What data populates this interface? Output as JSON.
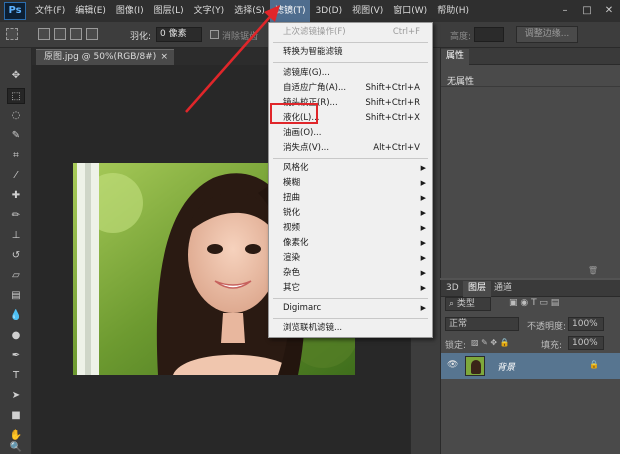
{
  "app": {
    "logo": "Ps"
  },
  "menubar": {
    "items": [
      "文件(F)",
      "编辑(E)",
      "图像(I)",
      "图层(L)",
      "文字(Y)",
      "选择(S)",
      "滤镜(T)",
      "3D(D)",
      "视图(V)",
      "窗口(W)",
      "帮助(H)"
    ],
    "active_index": 6
  },
  "window_controls": [
    "–",
    "□",
    "✕"
  ],
  "options": {
    "feather_label": "羽化:",
    "feather_value": "0 像素",
    "antialias_label": "消除锯齿",
    "height_label": "高度:",
    "refine_edge": "调整边缘..."
  },
  "document": {
    "tab_title": "原图.jpg @ 50%(RGB/8#)",
    "close_glyph": "×"
  },
  "properties_panel": {
    "tabs": [
      "属性"
    ],
    "no_properties": "无属性"
  },
  "layers_panel": {
    "tabs": [
      "3D",
      "图层",
      "通道"
    ],
    "filter_kind": "类型",
    "blend_mode": "正常",
    "opacity_label": "不透明度:",
    "opacity_value": "100%",
    "lock_label": "锁定:",
    "fill_label": "填充:",
    "fill_value": "100%",
    "layer_name": "背景"
  },
  "filter_menu": {
    "items": [
      {
        "label": "上次滤镜操作(F)",
        "shortcut": "Ctrl+F",
        "disabled": true
      },
      {
        "label": "转换为智能滤镜",
        "shortcut": ""
      },
      {
        "label": "滤镜库(G)...",
        "shortcut": ""
      },
      {
        "label": "自适应广角(A)...",
        "shortcut": "Shift+Ctrl+A"
      },
      {
        "label": "镜头校正(R)...",
        "shortcut": "Shift+Ctrl+R"
      },
      {
        "label": "液化(L)...",
        "shortcut": "Shift+Ctrl+X"
      },
      {
        "label": "油画(O)...",
        "shortcut": ""
      },
      {
        "label": "消失点(V)...",
        "shortcut": "Alt+Ctrl+V"
      },
      {
        "label": "风格化",
        "submenu": true
      },
      {
        "label": "模糊",
        "submenu": true
      },
      {
        "label": "扭曲",
        "submenu": true
      },
      {
        "label": "锐化",
        "submenu": true
      },
      {
        "label": "视频",
        "submenu": true
      },
      {
        "label": "像素化",
        "submenu": true
      },
      {
        "label": "渲染",
        "submenu": true
      },
      {
        "label": "杂色",
        "submenu": true
      },
      {
        "label": "其它",
        "submenu": true
      },
      {
        "label": "Digimarc",
        "submenu": true
      },
      {
        "label": "浏览联机滤镜..."
      }
    ],
    "highlighted_item": "液化(L)..."
  },
  "colors": {
    "accent": "#e0262a",
    "menu_active": "#4f6d8e",
    "layer_selected": "#577590"
  },
  "icons": [
    "arrow-annotation",
    "visibility-eye-icon",
    "lock-icon",
    "submenu-arrow-icon"
  ]
}
